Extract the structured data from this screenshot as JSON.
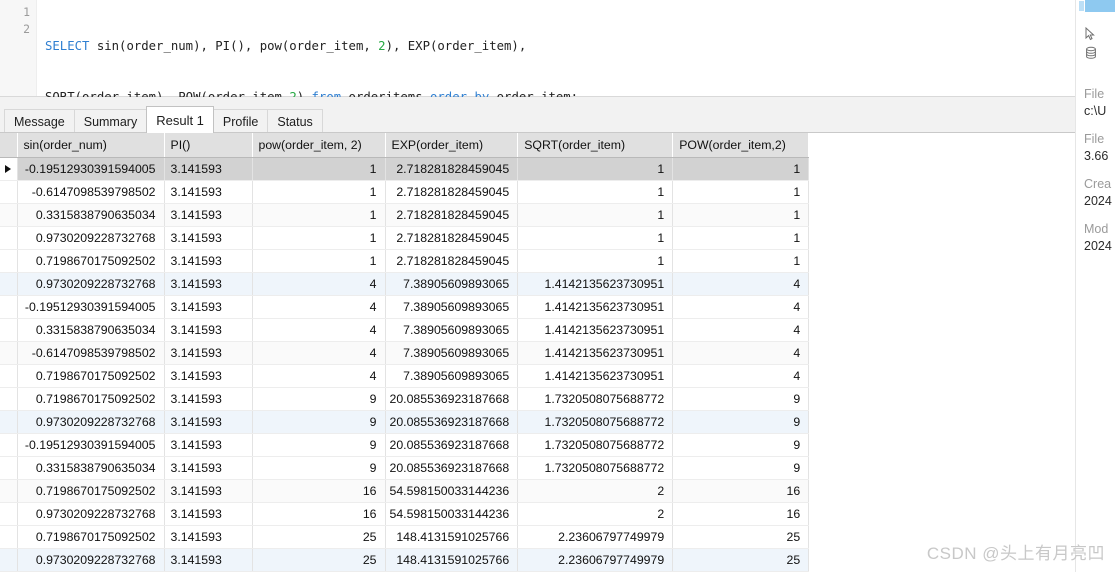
{
  "editor": {
    "line_numbers": [
      "1",
      "2"
    ],
    "line1": [
      {
        "t": "SELECT",
        "k": "kw"
      },
      {
        "t": " sin(order_num), PI(), pow(order_item, ",
        "k": "idf"
      },
      {
        "t": "2",
        "k": "num"
      },
      {
        "t": "), EXP(order_item),",
        "k": "idf"
      }
    ],
    "line2": [
      {
        "t": "SQRT(order_item), POW(order_item,",
        "k": "idf"
      },
      {
        "t": "2",
        "k": "num"
      },
      {
        "t": ") ",
        "k": "idf"
      },
      {
        "t": "from",
        "k": "kw"
      },
      {
        "t": " orderitems ",
        "k": "idf"
      },
      {
        "t": "order",
        "k": "kw"
      },
      {
        "t": " ",
        "k": "idf"
      },
      {
        "t": "by",
        "k": "kw"
      },
      {
        "t": " order_item;",
        "k": "idf"
      }
    ]
  },
  "tabs": [
    {
      "label": "Message",
      "active": false
    },
    {
      "label": "Summary",
      "active": false
    },
    {
      "label": "Result 1",
      "active": true
    },
    {
      "label": "Profile",
      "active": false
    },
    {
      "label": "Status",
      "active": false
    }
  ],
  "grid": {
    "columns": [
      "sin(order_num)",
      "PI()",
      "pow(order_item, 2)",
      "EXP(order_item)",
      "SQRT(order_item)",
      "POW(order_item,2)"
    ],
    "rows": [
      {
        "state": "selected",
        "cells": [
          "-0.19512930391594005",
          "3.141593",
          "1",
          "2.718281828459045",
          "1",
          "1"
        ]
      },
      {
        "state": "normal",
        "cells": [
          "-0.6147098539798502",
          "3.141593",
          "1",
          "2.718281828459045",
          "1",
          "1"
        ]
      },
      {
        "state": "alt",
        "cells": [
          "0.3315838790635034",
          "3.141593",
          "1",
          "2.718281828459045",
          "1",
          "1"
        ]
      },
      {
        "state": "normal",
        "cells": [
          "0.9730209228732768",
          "3.141593",
          "1",
          "2.718281828459045",
          "1",
          "1"
        ]
      },
      {
        "state": "normal",
        "cells": [
          "0.7198670175092502",
          "3.141593",
          "1",
          "2.718281828459045",
          "1",
          "1"
        ]
      },
      {
        "state": "hl",
        "cells": [
          "0.9730209228732768",
          "3.141593",
          "4",
          "7.38905609893065",
          "1.4142135623730951",
          "4"
        ]
      },
      {
        "state": "normal",
        "cells": [
          "-0.19512930391594005",
          "3.141593",
          "4",
          "7.38905609893065",
          "1.4142135623730951",
          "4"
        ]
      },
      {
        "state": "normal",
        "cells": [
          "0.3315838790635034",
          "3.141593",
          "4",
          "7.38905609893065",
          "1.4142135623730951",
          "4"
        ]
      },
      {
        "state": "alt",
        "cells": [
          "-0.6147098539798502",
          "3.141593",
          "4",
          "7.38905609893065",
          "1.4142135623730951",
          "4"
        ]
      },
      {
        "state": "normal",
        "cells": [
          "0.7198670175092502",
          "3.141593",
          "4",
          "7.38905609893065",
          "1.4142135623730951",
          "4"
        ]
      },
      {
        "state": "normal",
        "cells": [
          "0.7198670175092502",
          "3.141593",
          "9",
          "20.085536923187668",
          "1.7320508075688772",
          "9"
        ]
      },
      {
        "state": "hl",
        "cells": [
          "0.9730209228732768",
          "3.141593",
          "9",
          "20.085536923187668",
          "1.7320508075688772",
          "9"
        ]
      },
      {
        "state": "normal",
        "cells": [
          "-0.19512930391594005",
          "3.141593",
          "9",
          "20.085536923187668",
          "1.7320508075688772",
          "9"
        ]
      },
      {
        "state": "normal",
        "cells": [
          "0.3315838790635034",
          "3.141593",
          "9",
          "20.085536923187668",
          "1.7320508075688772",
          "9"
        ]
      },
      {
        "state": "alt",
        "cells": [
          "0.7198670175092502",
          "3.141593",
          "16",
          "54.598150033144236",
          "2",
          "16"
        ]
      },
      {
        "state": "normal",
        "cells": [
          "0.9730209228732768",
          "3.141593",
          "16",
          "54.598150033144236",
          "2",
          "16"
        ]
      },
      {
        "state": "normal",
        "cells": [
          "0.7198670175092502",
          "3.141593",
          "25",
          "148.4131591025766",
          "2.23606797749979",
          "25"
        ]
      },
      {
        "state": "hl",
        "cells": [
          "0.9730209228732768",
          "3.141593",
          "25",
          "148.4131591025766",
          "2.23606797749979",
          "25"
        ]
      }
    ]
  },
  "right_panel": {
    "icons": [
      "cursor-icon",
      "database-icon"
    ],
    "sections": [
      {
        "label": "File",
        "value": "c:\\U"
      },
      {
        "label": "File",
        "value": "3.66"
      },
      {
        "label": "Crea",
        "value": "2024"
      },
      {
        "label": "Mod",
        "value": "2024"
      }
    ]
  },
  "watermark": "CSDN @头上有月亮凹"
}
